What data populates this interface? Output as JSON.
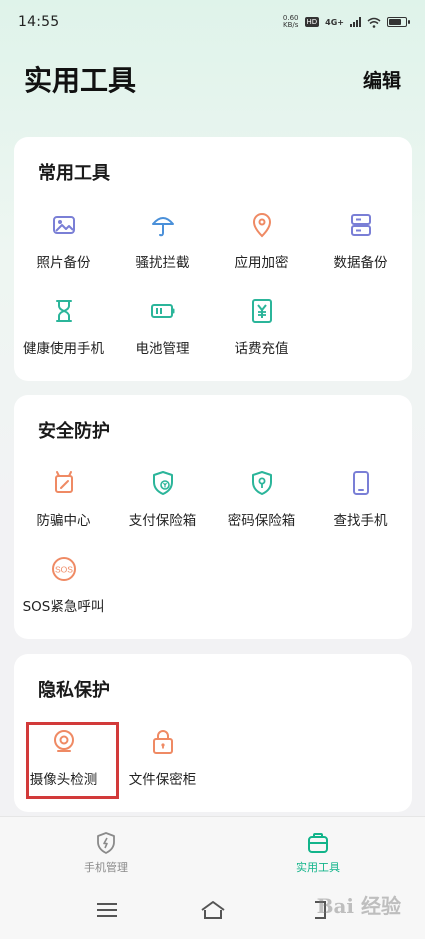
{
  "status_bar": {
    "time": "14:55",
    "net_speed_value": "0.60",
    "net_speed_unit": "KB/s",
    "hd_badge": "HD",
    "network_type": "4G+",
    "battery_level": 0.8
  },
  "header": {
    "title": "实用工具",
    "edit_label": "编辑"
  },
  "sections": [
    {
      "title": "常用工具",
      "items": [
        {
          "label": "照片备份",
          "icon": "photo-backup-icon"
        },
        {
          "label": "骚扰拦截",
          "icon": "umbrella-icon"
        },
        {
          "label": "应用加密",
          "icon": "app-lock-icon"
        },
        {
          "label": "数据备份",
          "icon": "data-backup-icon"
        },
        {
          "label": "健康使用手机",
          "icon": "hourglass-icon"
        },
        {
          "label": "电池管理",
          "icon": "battery-icon"
        },
        {
          "label": "话费充值",
          "icon": "yuan-recharge-icon"
        }
      ]
    },
    {
      "title": "安全防护",
      "items": [
        {
          "label": "防骗中心",
          "icon": "anti-fraud-icon"
        },
        {
          "label": "支付保险箱",
          "icon": "payment-shield-icon"
        },
        {
          "label": "密码保险箱",
          "icon": "password-shield-icon"
        },
        {
          "label": "查找手机",
          "icon": "find-phone-icon"
        },
        {
          "label": "SOS紧急呼叫",
          "icon": "sos-icon"
        }
      ]
    },
    {
      "title": "隐私保护",
      "items": [
        {
          "label": "摄像头检测",
          "icon": "camera-detect-icon"
        },
        {
          "label": "文件保密柜",
          "icon": "file-vault-icon"
        }
      ]
    }
  ],
  "bottom_nav": [
    {
      "label": "手机管理",
      "icon": "phone-manager-icon",
      "active": false
    },
    {
      "label": "实用工具",
      "icon": "toolbox-icon",
      "active": true
    }
  ],
  "colors": {
    "accent_green": "#12b48a",
    "icon_blue": "#4a90d9",
    "icon_orange": "#ef8a64",
    "icon_teal": "#2bb59a",
    "icon_purple": "#7a7fd6",
    "highlight_red": "#d23a3a",
    "inactive_gray": "#8a8a8a"
  },
  "watermark": "Bai 经验"
}
